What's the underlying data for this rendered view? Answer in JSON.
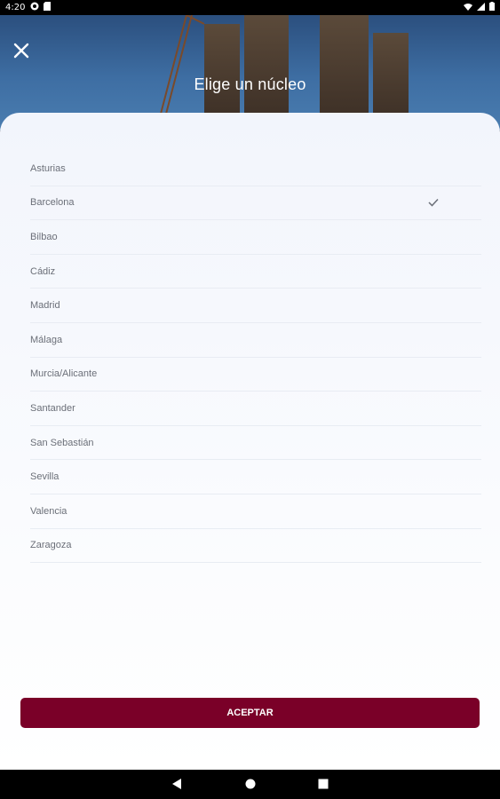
{
  "status_bar": {
    "time": "4:20",
    "left_icons": [
      "pocket-casts-icon",
      "sd-card-icon"
    ],
    "right_icons": [
      "wifi-icon",
      "signal-icon",
      "battery-icon"
    ]
  },
  "header": {
    "title": "Elige un núcleo",
    "close_icon": "close-icon"
  },
  "list": {
    "items": [
      {
        "label": "Asturias",
        "selected": false
      },
      {
        "label": "Barcelona",
        "selected": true
      },
      {
        "label": "Bilbao",
        "selected": false
      },
      {
        "label": "Cádiz",
        "selected": false
      },
      {
        "label": "Madrid",
        "selected": false
      },
      {
        "label": "Málaga",
        "selected": false
      },
      {
        "label": "Murcia/Alicante",
        "selected": false
      },
      {
        "label": "Santander",
        "selected": false
      },
      {
        "label": "San Sebastián",
        "selected": false
      },
      {
        "label": "Sevilla",
        "selected": false
      },
      {
        "label": "Valencia",
        "selected": false
      },
      {
        "label": "Zaragoza",
        "selected": false
      }
    ]
  },
  "footer": {
    "accept_label": "ACEPTAR"
  },
  "nav_bar": {
    "icons": [
      "back-icon",
      "home-icon",
      "recents-icon"
    ]
  },
  "colors": {
    "accent": "#7a0028",
    "text_muted": "#6b6f78",
    "divider": "#e8ecf3"
  }
}
